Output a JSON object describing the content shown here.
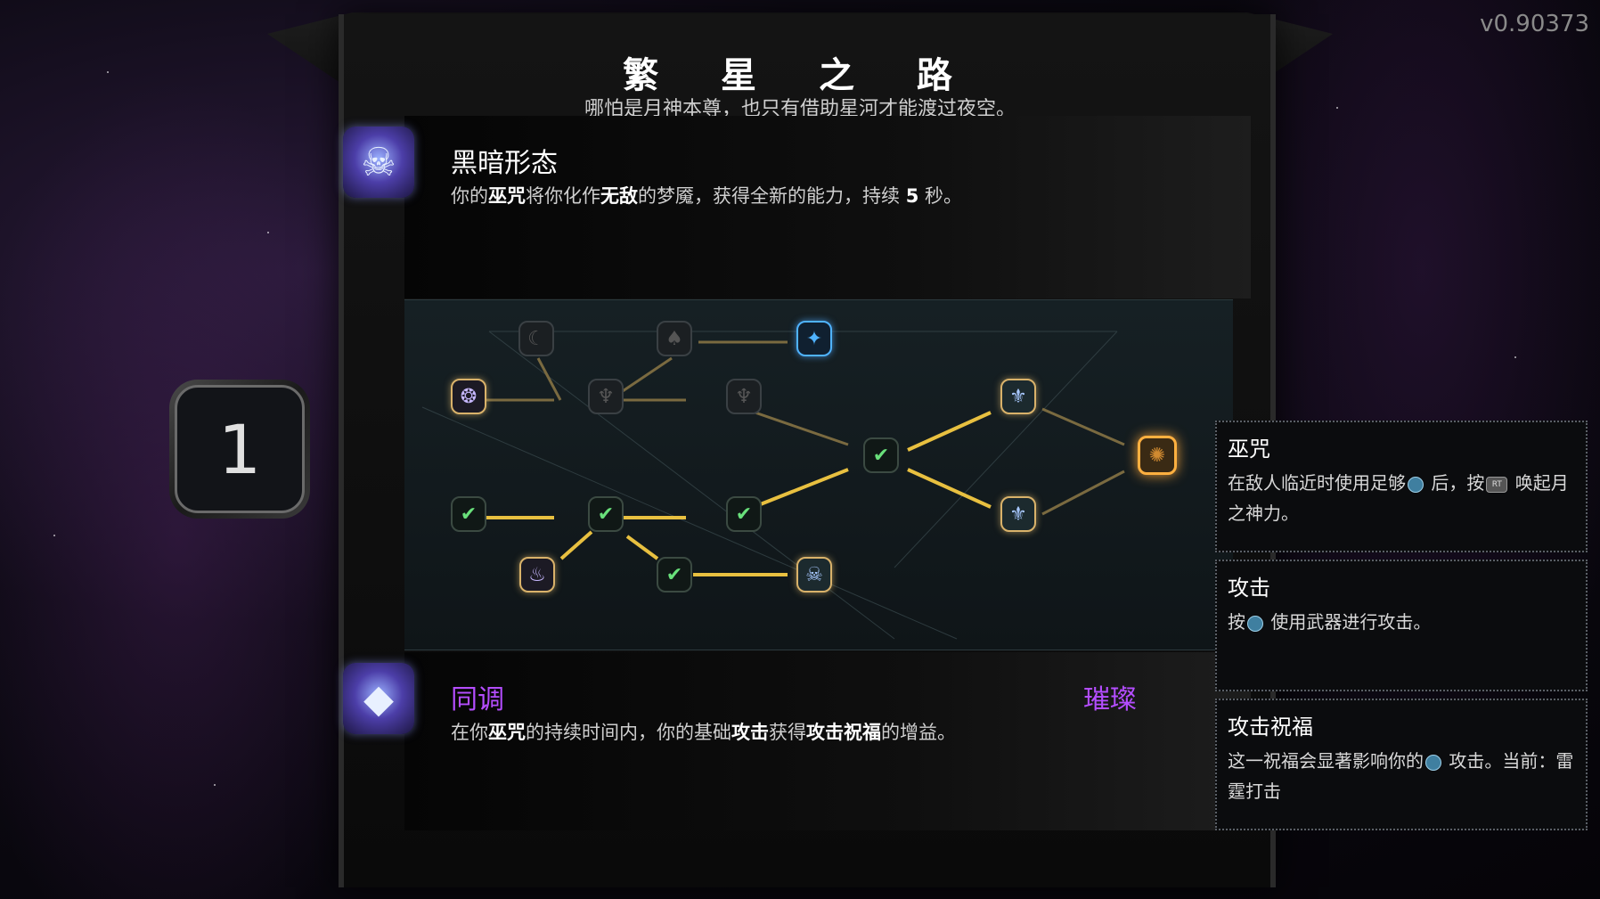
{
  "version": "v0.90373",
  "header": {
    "title": "繁 星 之 路",
    "subtitle": "哪怕是月神本尊，也只有借助星河才能渡过夜空。"
  },
  "top_ability": {
    "icon": "dark-form-icon",
    "name": "黑暗形态",
    "desc_parts": [
      "你的",
      "巫咒",
      "将你化作",
      "无敌",
      "的梦魇，获得全新的能力，持续 ",
      "5",
      " 秒。"
    ]
  },
  "bottom_ability": {
    "icon": "attunement-icon",
    "name": "同调",
    "rarity": "璀璨",
    "desc_parts": [
      "在你",
      "巫咒",
      "的持续时间内，你的基础",
      "攻击",
      "获得",
      "攻击祝福",
      "的增益。"
    ]
  },
  "rank": "1",
  "tooltips": [
    {
      "title": "巫咒",
      "body_parts": [
        "在敌人临近时使用足够",
        "",
        " 后，按",
        "RT",
        " 唤起月之神力。"
      ]
    },
    {
      "title": "攻击",
      "body_parts": [
        "按",
        "",
        " 使用武器进行攻击。"
      ]
    },
    {
      "title": "攻击祝福",
      "body_parts": [
        "这一祝福会显著影响你的",
        "",
        " 攻击。当前：雷霆打击"
      ]
    }
  ],
  "colors": {
    "accent_gold": "#e8c040",
    "rarity_purple": "#b44dff",
    "final_node": "#ffb040"
  }
}
